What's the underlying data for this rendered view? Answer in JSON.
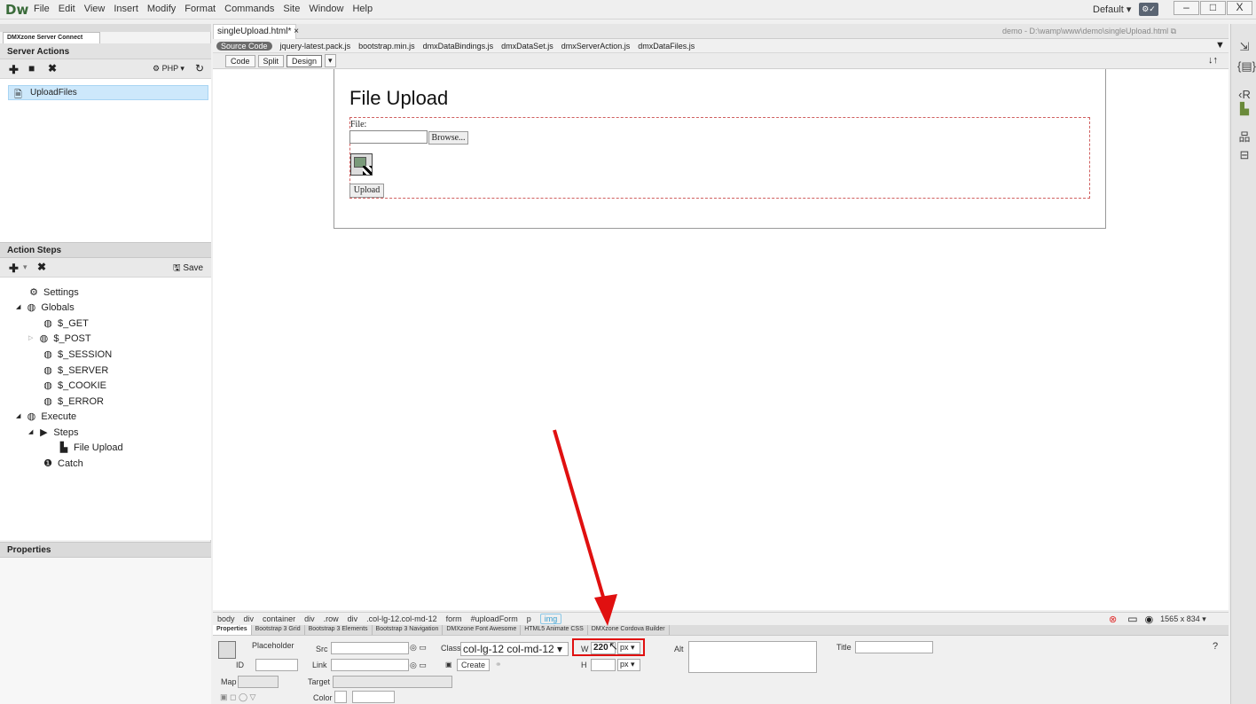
{
  "app": {
    "logo": "Dw",
    "menu": [
      "File",
      "Edit",
      "View",
      "Insert",
      "Modify",
      "Format",
      "Commands",
      "Site",
      "Window",
      "Help"
    ],
    "workspace": "Default",
    "window_controls": [
      "–",
      "□",
      "X"
    ]
  },
  "left_panel": {
    "panel_tab": "DMXzone Server Connect",
    "server_actions": {
      "title": "Server Actions",
      "lang": "PHP",
      "items": [
        "UploadFiles"
      ]
    },
    "action_steps": {
      "title": "Action Steps",
      "save_label": "Save",
      "tree": [
        {
          "label": "Settings",
          "icon": "gear-icon"
        },
        {
          "label": "Globals",
          "icon": "cube-icon"
        },
        {
          "label": "$_GET",
          "icon": "cube-icon"
        },
        {
          "label": "$_POST",
          "icon": "cube-icon"
        },
        {
          "label": "$_SESSION",
          "icon": "cube-icon"
        },
        {
          "label": "$_SERVER",
          "icon": "cube-icon"
        },
        {
          "label": "$_COOKIE",
          "icon": "cube-icon"
        },
        {
          "label": "$_ERROR",
          "icon": "cube-icon"
        },
        {
          "label": "Execute",
          "icon": "cube-icon"
        },
        {
          "label": "Steps",
          "icon": "play-icon"
        },
        {
          "label": "File Upload",
          "icon": "file-icon"
        },
        {
          "label": "Catch",
          "icon": "alert-icon"
        }
      ]
    },
    "properties_title": "Properties"
  },
  "document": {
    "tab": "singleUpload.html*",
    "path": "demo - D:\\wamp\\www\\demo\\singleUpload.html",
    "related_files": [
      "Source Code",
      "jquery-latest.pack.js",
      "bootstrap.min.js",
      "dmxDataBindings.js",
      "dmxDataSet.js",
      "dmxServerAction.js",
      "dmxDataFiles.js"
    ],
    "views": [
      "Code",
      "Split",
      "Design"
    ],
    "page_title": "File Upload",
    "file_label": "File:",
    "browse_label": "Browse...",
    "upload_label": "Upload"
  },
  "tag_selector": {
    "tags": [
      "body",
      "div",
      "container",
      "div",
      ".row",
      "div",
      ".col-lg-12.col-md-12",
      "form",
      "#uploadForm",
      "p",
      "img"
    ],
    "window_size": "1565 x 834"
  },
  "properties": {
    "tabs": [
      "Properties",
      "Bootstrap 3 Grid",
      "Bootstrap 3 Elements",
      "Bootstrap 3 Navigation",
      "DMXzone Font Awesome",
      "HTML5 Animate CSS",
      "DMXzone Cordova Builder"
    ],
    "placeholder_label": "Placeholder",
    "id_label": "ID",
    "src_label": "Src",
    "link_label": "Link",
    "class_label": "Class",
    "class_value": "col-lg-12 col-md-12",
    "create_label": "Create",
    "w_label": "W",
    "w_value": "220",
    "h_label": "H",
    "unit": "px",
    "alt_label": "Alt",
    "title_label": "Title",
    "map_label": "Map",
    "target_label": "Target",
    "color_label": "Color"
  },
  "colors": {
    "accent": "#e01010",
    "selection": "#cde8fb"
  }
}
